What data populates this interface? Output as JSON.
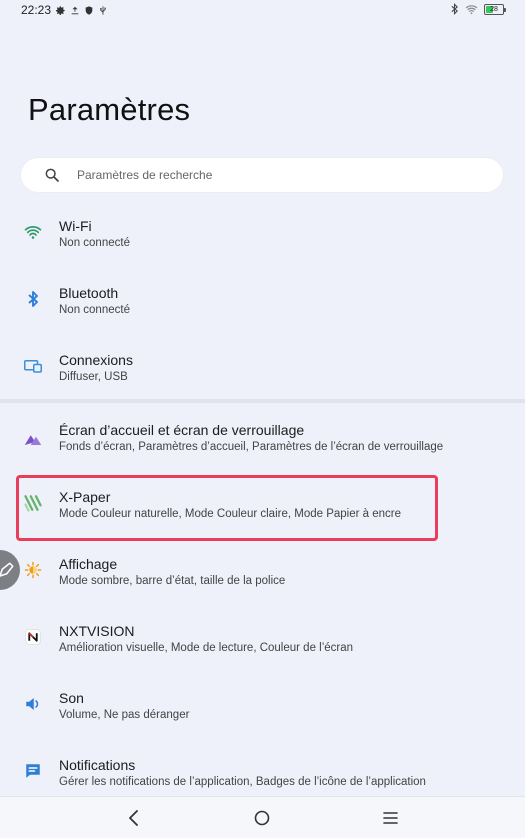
{
  "status_bar": {
    "time": "22:23",
    "left_icons": [
      "gear-icon",
      "upload-icon",
      "shield-icon",
      "usb-icon"
    ],
    "right_icons": [
      "bluetooth-icon",
      "wifi-icon",
      "battery-icon"
    ],
    "battery_level": "28"
  },
  "page": {
    "title": "Paramètres"
  },
  "search": {
    "placeholder": "Paramètres de recherche",
    "icon": "search-icon"
  },
  "items": [
    {
      "title": "Wi-Fi",
      "subtitle": "Non connecté",
      "icon": "wifi-icon",
      "icon_color": "#2e9a68"
    },
    {
      "title": "Bluetooth",
      "subtitle": "Non connecté",
      "icon": "bluetooth-icon",
      "icon_color": "#2f7fd6"
    },
    {
      "title": "Connexions",
      "subtitle": "Diffuser, USB",
      "icon": "connections-icon",
      "icon_color": "#3a8fd8"
    },
    {
      "title": "Écran d’accueil et écran de verrouillage",
      "subtitle": "Fonds d’écran, Paramètres d’accueil, Paramètres de l’écran de verrouillage",
      "icon": "home-screen-icon",
      "icon_color": "#7b52c7"
    },
    {
      "title": "X-Paper",
      "subtitle": "Mode Couleur naturelle, Mode Couleur claire, Mode Papier à encre",
      "icon": "x-paper-icon",
      "icon_color": "#63b36a"
    },
    {
      "title": "Affichage",
      "subtitle": "Mode sombre, barre d’état, taille de la police",
      "icon": "display-icon",
      "icon_color": "#f39c1a"
    },
    {
      "title": "NXTVISION",
      "subtitle": "Amélioration visuelle, Mode de lecture, Couleur de l’écran",
      "icon": "nxtvision-icon",
      "icon_color": "#d62d2d"
    },
    {
      "title": "Son",
      "subtitle": "Volume, Ne pas déranger",
      "icon": "sound-icon",
      "icon_color": "#2f7fd6"
    },
    {
      "title": "Notifications",
      "subtitle": "Gérer les notifications de l’application, Badges de l’icône de l’application",
      "icon": "notifications-icon",
      "icon_color": "#2f7fd6"
    }
  ],
  "highlight_color": "#e83e5b",
  "nav_bar": {
    "buttons": [
      "back-icon",
      "home-icon",
      "menu-icon"
    ]
  }
}
